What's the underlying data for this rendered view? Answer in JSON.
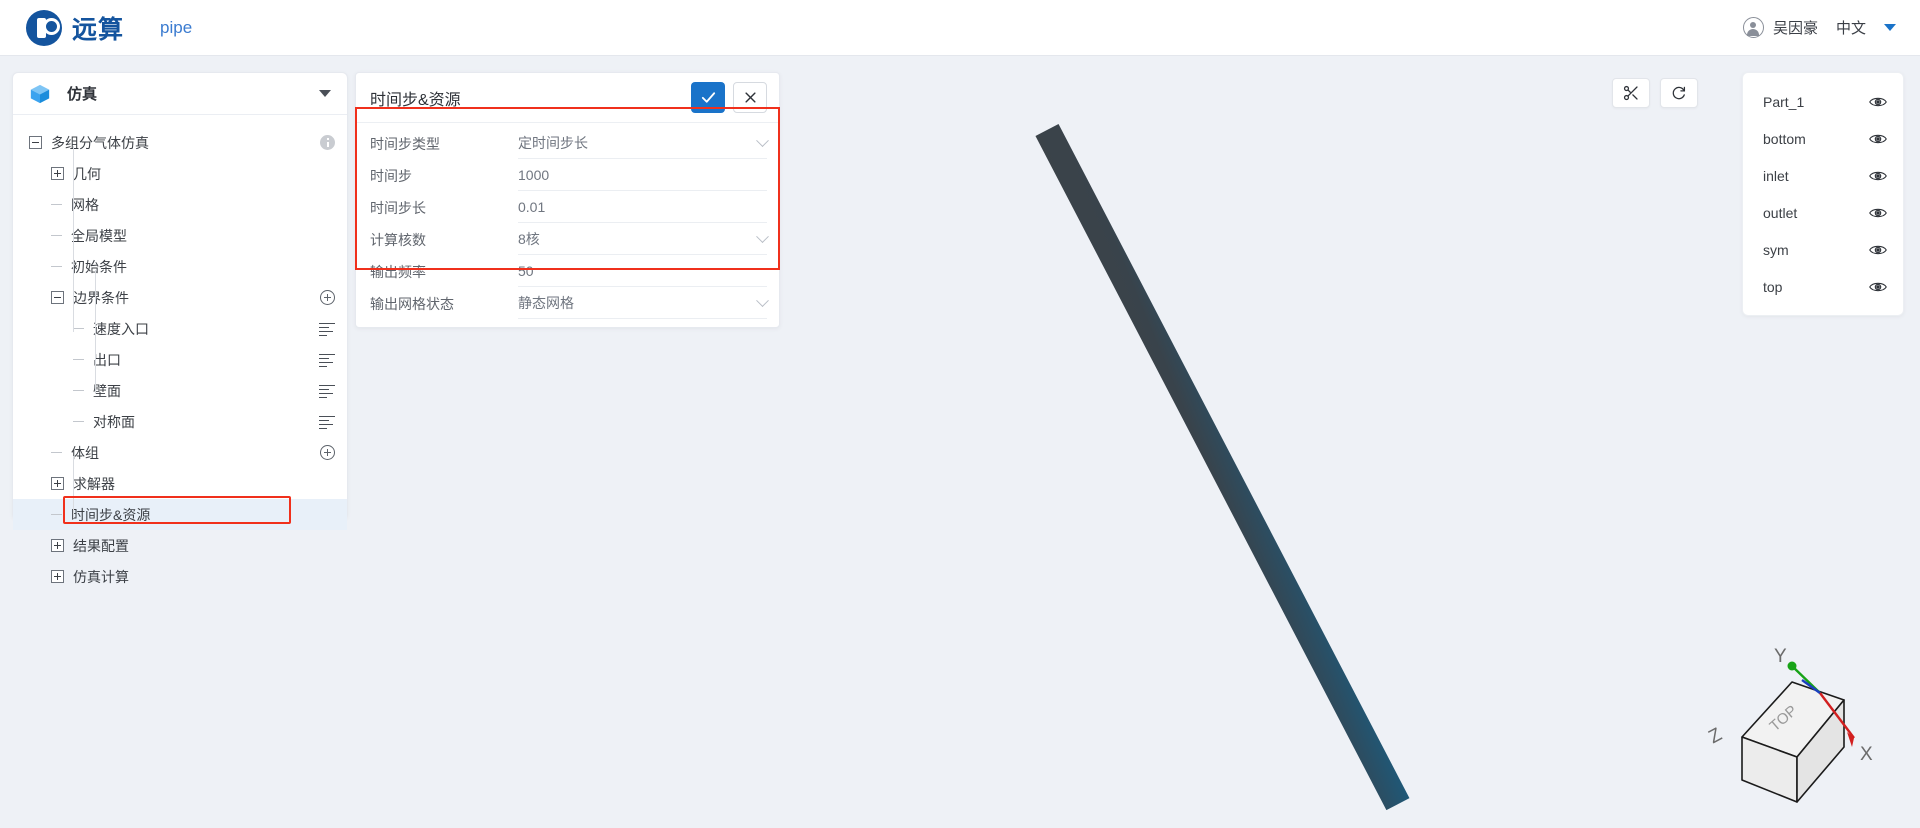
{
  "topbar": {
    "brand_name": "远算",
    "app_name": "pipe",
    "user_name": "吴因豪",
    "language": "中文",
    "avatar_icon": "user-circle-icon",
    "caret_icon": "caret-down-icon",
    "brand_color": "#14549e"
  },
  "sidebar": {
    "header_title": "仿真",
    "header_icon": "cube-icon",
    "collapse_icon": "caret-down-icon",
    "tree": [
      {
        "label": "多组分气体仿真",
        "depth": 0,
        "toggle": "minus",
        "icon": "info-circle-icon",
        "selected": false
      },
      {
        "label": "几何",
        "depth": 1,
        "toggle": "plus",
        "icon": "none",
        "selected": false
      },
      {
        "label": "网格",
        "depth": 1,
        "toggle": "dash",
        "icon": "none",
        "selected": false
      },
      {
        "label": "全局模型",
        "depth": 1,
        "toggle": "dash",
        "icon": "none",
        "selected": false
      },
      {
        "label": "初始条件",
        "depth": 1,
        "toggle": "dash",
        "icon": "none",
        "selected": false
      },
      {
        "label": "边界条件",
        "depth": 1,
        "toggle": "minus",
        "icon": "plus-circle-icon",
        "selected": false
      },
      {
        "label": "速度入口",
        "depth": 2,
        "toggle": "dash",
        "icon": "list-icon",
        "selected": false
      },
      {
        "label": "出口",
        "depth": 2,
        "toggle": "dash",
        "icon": "list-icon",
        "selected": false
      },
      {
        "label": "壁面",
        "depth": 2,
        "toggle": "dash",
        "icon": "list-icon",
        "selected": false
      },
      {
        "label": "对称面",
        "depth": 2,
        "toggle": "dash",
        "icon": "list-icon",
        "selected": false
      },
      {
        "label": "体组",
        "depth": 1,
        "toggle": "dash",
        "icon": "plus-circle-icon",
        "selected": false
      },
      {
        "label": "求解器",
        "depth": 1,
        "toggle": "plus",
        "icon": "none",
        "selected": false
      },
      {
        "label": "时间步&资源",
        "depth": 1,
        "toggle": "dash",
        "icon": "none",
        "selected": true
      },
      {
        "label": "结果配置",
        "depth": 1,
        "toggle": "plus",
        "icon": "none",
        "selected": false
      },
      {
        "label": "仿真计算",
        "depth": 1,
        "toggle": "plus",
        "icon": "none",
        "selected": false
      }
    ],
    "highlight_color": "#f0301c"
  },
  "form_panel": {
    "title": "时间步&资源",
    "confirm_label": "✓",
    "confirm_icon": "check-icon",
    "cancel_icon": "close-icon",
    "confirm_color": "#1a73c9",
    "highlight_color": "#f0301c",
    "fields": [
      {
        "label": "时间步类型",
        "value": "定时间步长",
        "control": "select",
        "highlighted": true
      },
      {
        "label": "时间步",
        "value": "1000",
        "control": "input",
        "highlighted": true
      },
      {
        "label": "时间步长",
        "value": "0.01",
        "control": "input",
        "highlighted": true
      },
      {
        "label": "计算核数",
        "value": "8核",
        "control": "select",
        "highlighted": true
      },
      {
        "label": "输出频率",
        "value": "50",
        "control": "input",
        "highlighted": true
      },
      {
        "label": "输出网格状态",
        "value": "静态网格",
        "control": "select",
        "highlighted": false
      }
    ]
  },
  "viewport": {
    "background_color": "#eef1f6",
    "model_color": "#2b4e63",
    "tools": [
      {
        "icon": "scissors-icon",
        "name": "clip-tool"
      },
      {
        "icon": "reset-rotate-icon",
        "name": "reset-view-tool"
      }
    ],
    "gizmo": {
      "face_label": "TOP",
      "axis_x": "X",
      "axis_y": "Y",
      "axis_z": "Z",
      "x_color": "#d21f1f",
      "y_color": "#17a317",
      "z_color": "#1b3fbf"
    }
  },
  "parts_panel": {
    "items": [
      {
        "name": "Part_1",
        "visibility_icon": "eye-icon"
      },
      {
        "name": "bottom",
        "visibility_icon": "eye-icon"
      },
      {
        "name": "inlet",
        "visibility_icon": "eye-icon"
      },
      {
        "name": "outlet",
        "visibility_icon": "eye-icon"
      },
      {
        "name": "sym",
        "visibility_icon": "eye-icon"
      },
      {
        "name": "top",
        "visibility_icon": "eye-icon"
      }
    ]
  }
}
